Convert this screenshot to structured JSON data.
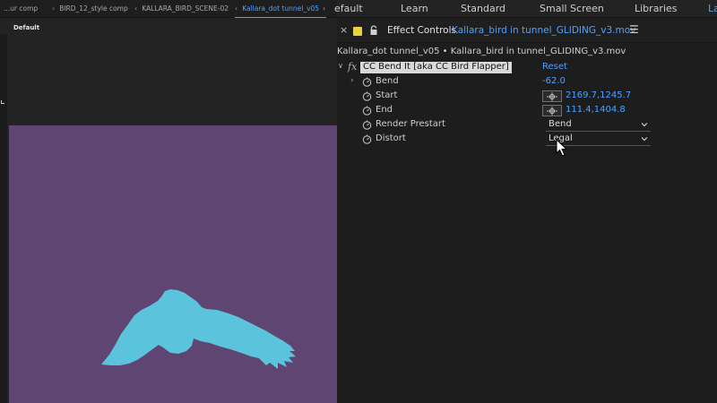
{
  "comp_tabs": [
    {
      "label": "...ur comp",
      "active": false
    },
    {
      "label": "BIRD_12_style comp",
      "active": false
    },
    {
      "label": "KALLARA_BIRD_SCENE-02",
      "active": false
    },
    {
      "label": "Kallara_dot tunnel_v05",
      "active": true
    }
  ],
  "viewer": {
    "label": "Default",
    "canvas_color": "#5f4672",
    "bird_color": "#5bc4dc"
  },
  "workspaces": [
    {
      "label": "efault",
      "active": false
    },
    {
      "label": "Learn",
      "active": false
    },
    {
      "label": "Standard",
      "active": false
    },
    {
      "label": "Small Screen",
      "active": false
    },
    {
      "label": "Libraries",
      "active": false
    },
    {
      "label": "La",
      "active": true
    }
  ],
  "effect_controls": {
    "panel_title": "Effect Controls",
    "layer_name": "Kallara_bird in tunnel_GLIDING_v3.mov",
    "breadcrumb": "Kallara_dot tunnel_v05 • Kallara_bird in tunnel_GLIDING_v3.mov",
    "fx_badge": "fx",
    "effect_name": "CC Bend It [aka CC Bird Flapper]",
    "reset_label": "Reset",
    "properties": {
      "bend": {
        "label": "Bend",
        "value": "-62.0"
      },
      "start": {
        "label": "Start",
        "value": "2169.7,1245.7"
      },
      "end": {
        "label": "End",
        "value": "111.4,1404.8"
      },
      "render_prestart": {
        "label": "Render Prestart",
        "value": "Bend"
      },
      "distort": {
        "label": "Distort",
        "value": "Legal"
      }
    }
  },
  "colors": {
    "accent": "#4ea1ff",
    "panel_bg": "#1d1d1d",
    "label_swatch": "#e8d440"
  }
}
